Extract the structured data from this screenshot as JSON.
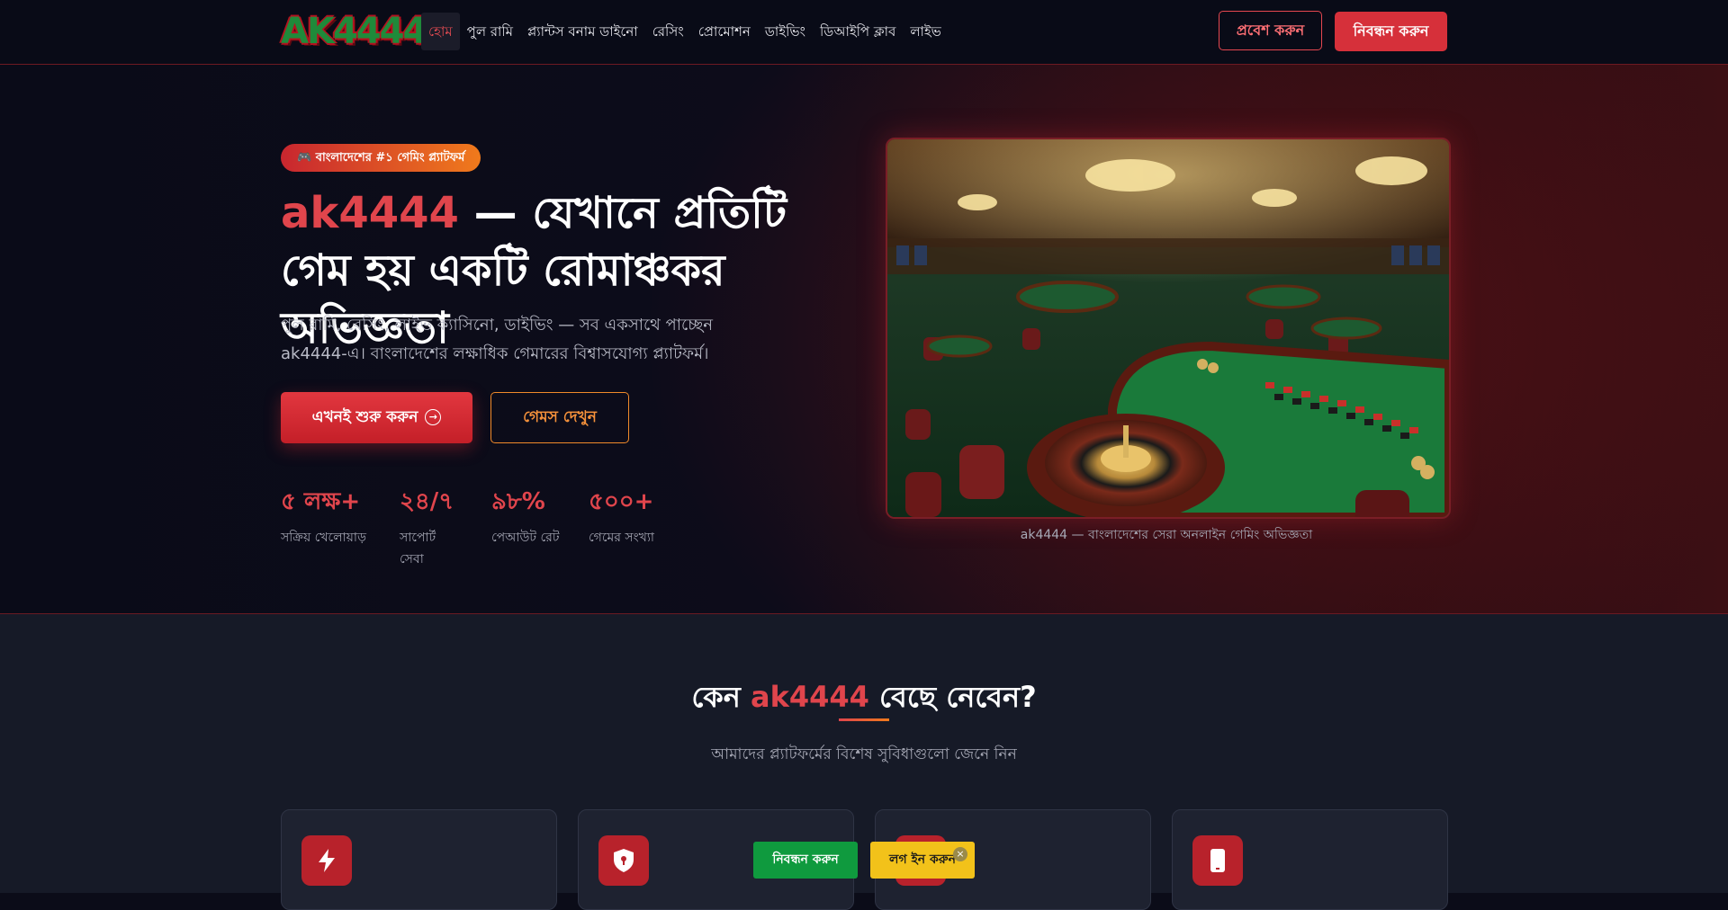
{
  "header": {
    "logo_text": "AK4444",
    "nav": [
      {
        "label": "হোম",
        "active": true
      },
      {
        "label": "পুল রামি"
      },
      {
        "label": "প্ল্যান্টস বনাম ডাইনো"
      },
      {
        "label": "রেসিং"
      },
      {
        "label": "প্রোমোশন"
      },
      {
        "label": "ডাইভিং"
      },
      {
        "label": "ডিআইপি ক্লাব"
      },
      {
        "label": "লাইভ"
      }
    ],
    "login_label": "প্রবেশ করুন",
    "register_label": "নিবন্ধন করুন"
  },
  "hero": {
    "badge": "🎮 বাংলাদেশের #১ গেমিং প্ল্যাটফর্ম",
    "title_brand": "ak4444",
    "title_rest": " — যেখানে প্রতিটি গেম হয় একটি রোমাঞ্চকর অভিজ্ঞতা",
    "subtitle": "পুল রামি, রেসিং, লাইভ ক্যাসিনো, ডাইভিং — সব একসাথে পাচ্ছেন ak4444-এ। বাংলাদেশের লক্ষাধিক গেমারের বিশ্বাসযোগ্য প্ল্যাটফর্ম।",
    "cta_primary": "এখনই শুরু করুন",
    "cta_secondary": "গেমস দেখুন",
    "stats": [
      {
        "value": "৫ লক্ষ+",
        "label": "সক্রিয় খেলোয়াড়"
      },
      {
        "value": "২৪/৭",
        "label": "সাপোর্ট সেবা"
      },
      {
        "value": "৯৮%",
        "label": "পেআউট রেট"
      },
      {
        "value": "৫০০+",
        "label": "গেমের সংখ্যা"
      }
    ],
    "image_caption": "ak4444 — বাংলাদেশের সেরা অনলাইন গেমিং অভিজ্ঞতা"
  },
  "why": {
    "title_prefix": "কেন ",
    "title_brand": "ak4444",
    "title_suffix": " বেছে নেবেন?",
    "subtitle": "আমাদের প্ল্যাটফর্মের বিশেষ সুবিধাগুলো জেনে নিন",
    "cards": [
      {
        "icon": "lightning-icon"
      },
      {
        "icon": "shield-icon"
      },
      {
        "icon": "gift-icon"
      },
      {
        "icon": "mobile-icon"
      }
    ]
  },
  "floating": {
    "register_label": "নিবন্ধন করুন",
    "login_label": "লগ ইন করুন",
    "close_glyph": "×"
  },
  "colors": {
    "accent_red": "#e0454c",
    "accent_orange": "#f07a1c",
    "background": "#0b0c18",
    "green": "#0f9a3e",
    "yellow": "#f2c21a"
  }
}
